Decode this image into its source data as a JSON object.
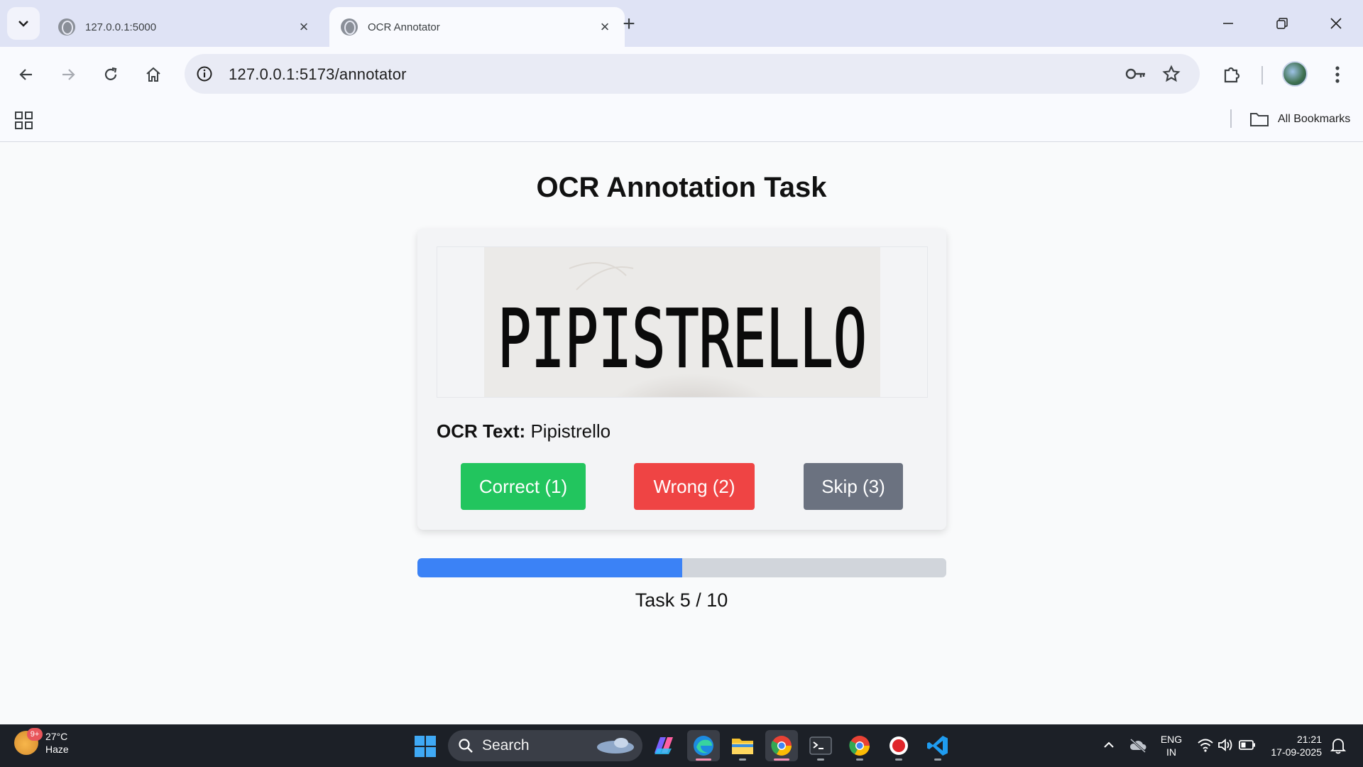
{
  "browser": {
    "tabs": [
      {
        "title": "127.0.0.1:5000",
        "active": false
      },
      {
        "title": "OCR Annotator",
        "active": true
      }
    ],
    "url": "127.0.0.1:5173/annotator",
    "bookmarks_label": "All Bookmarks"
  },
  "page": {
    "title": "OCR Annotation Task",
    "image_word": "PIPISTRELLO",
    "ocr_label": "OCR Text:",
    "ocr_value": "Pipistrello",
    "buttons": {
      "correct": "Correct (1)",
      "wrong": "Wrong (2)",
      "skip": "Skip (3)"
    },
    "progress_fraction": 0.5,
    "task_counter": "Task 5 / 10"
  },
  "taskbar": {
    "weather_temp": "27°C",
    "weather_cond": "Haze",
    "weather_badge": "9+",
    "search_label": "Search",
    "lang_line1": "ENG",
    "lang_line2": "IN",
    "time": "21:21",
    "date": "17-09-2025"
  },
  "colors": {
    "correct": "#22c55e",
    "wrong": "#ef4444",
    "skip": "#6b7280",
    "progress": "#3b82f6"
  }
}
